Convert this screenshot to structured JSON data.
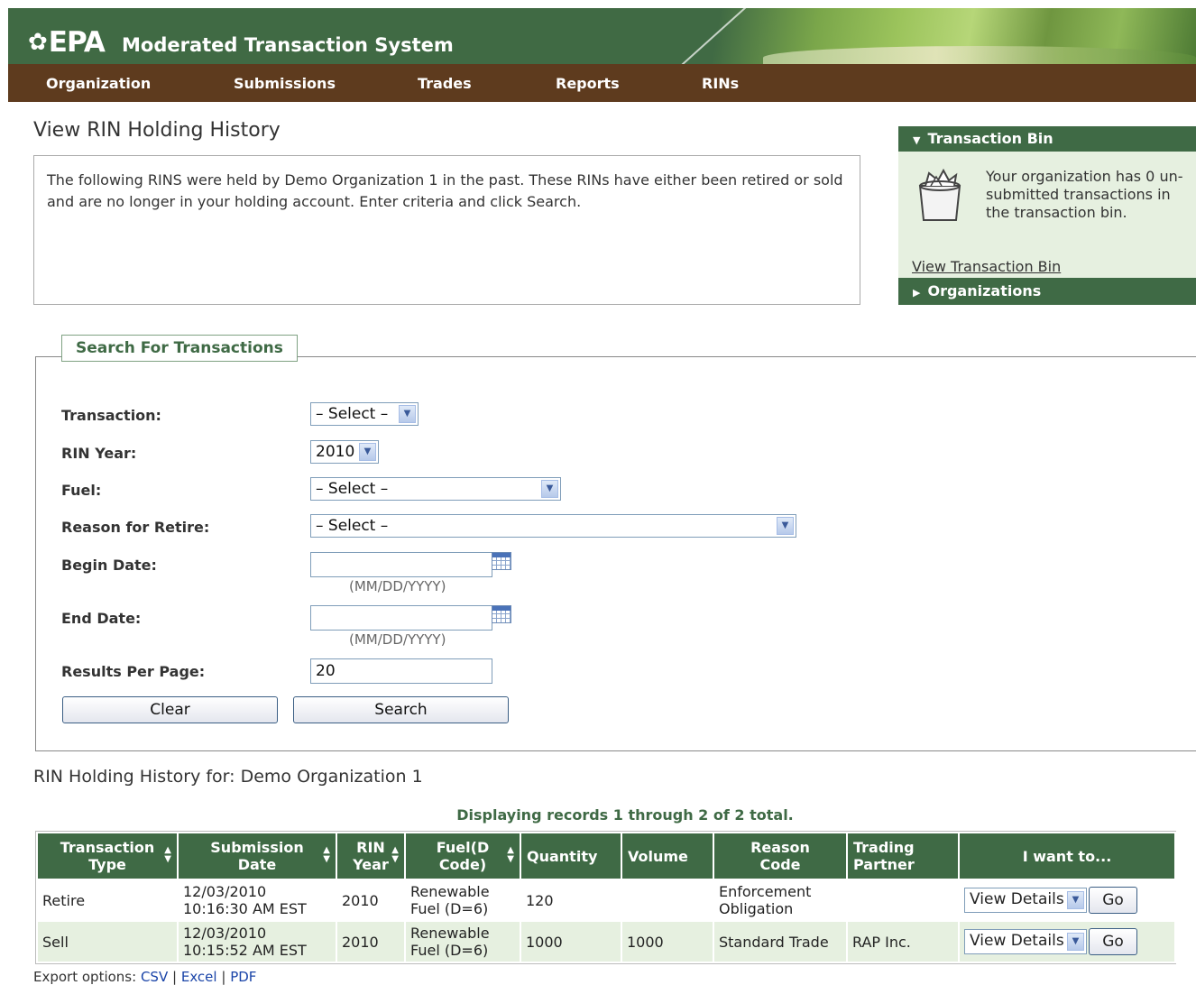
{
  "header": {
    "logo_text": "EPA",
    "app_title": "Moderated Transaction System"
  },
  "nav": {
    "items": [
      {
        "label": "Organization"
      },
      {
        "label": "Submissions"
      },
      {
        "label": "Trades"
      },
      {
        "label": "Reports"
      },
      {
        "label": "RINs"
      }
    ]
  },
  "page": {
    "title": "View RIN Holding History",
    "intro": "The following RINS were held by Demo Organization 1 in the past. These RINs have either been retired or sold and are no longer in your holding account. Enter criteria and click Search."
  },
  "sidebar": {
    "transaction_bin": {
      "title": "Transaction Bin",
      "message": "Your organization has 0 un-submitted transactions in the transaction bin.",
      "link": "View Transaction Bin"
    },
    "organizations": {
      "title": "Organizations"
    }
  },
  "search": {
    "legend": "Search For Transactions",
    "fields": {
      "transaction": {
        "label": "Transaction:",
        "value": "– Select –"
      },
      "rin_year": {
        "label": "RIN Year:",
        "value": "2010"
      },
      "fuel": {
        "label": "Fuel:",
        "value": "– Select –"
      },
      "reason": {
        "label": "Reason for Retire:",
        "value": "– Select –"
      },
      "begin_date": {
        "label": "Begin Date:",
        "value": "",
        "hint": "(MM/DD/YYYY)"
      },
      "end_date": {
        "label": "End Date:",
        "value": "",
        "hint": "(MM/DD/YYYY)"
      },
      "results_per_page": {
        "label": "Results Per Page:",
        "value": "20"
      }
    },
    "clear_label": "Clear",
    "search_label": "Search"
  },
  "results": {
    "title": "RIN Holding History for: Demo Organization 1",
    "display_count": "Displaying records 1 through 2 of 2 total.",
    "columns": [
      {
        "line1": "Transaction",
        "line2": "Type"
      },
      {
        "line1": "Submission",
        "line2": "Date"
      },
      {
        "line1": "RIN",
        "line2": "Year"
      },
      {
        "line1": "Fuel(D",
        "line2": "Code)"
      },
      {
        "line1": "Quantity",
        "line2": ""
      },
      {
        "line1": "Volume",
        "line2": ""
      },
      {
        "line1": "Reason",
        "line2": "Code"
      },
      {
        "line1": "Trading",
        "line2": "Partner"
      },
      {
        "line1": "I want to...",
        "line2": ""
      }
    ],
    "rows": [
      {
        "type": "Retire",
        "date1": "12/03/2010",
        "date2": "10:16:30 AM EST",
        "year": "2010",
        "fuel1": "Renewable",
        "fuel2": "Fuel (D=6)",
        "quantity": "120",
        "volume": "",
        "reason1": "Enforcement",
        "reason2": "Obligation",
        "partner": "",
        "action": "View Details",
        "go": "Go"
      },
      {
        "type": "Sell",
        "date1": "12/03/2010",
        "date2": "10:15:52 AM EST",
        "year": "2010",
        "fuel1": "Renewable",
        "fuel2": "Fuel (D=6)",
        "quantity": "1000",
        "volume": "1000",
        "reason1": "Standard Trade",
        "reason2": "",
        "partner": "RAP Inc.",
        "action": "View Details",
        "go": "Go"
      }
    ],
    "export": {
      "prefix": "Export options:",
      "csv": "CSV",
      "excel": "Excel",
      "pdf": "PDF",
      "sep": "|"
    }
  }
}
